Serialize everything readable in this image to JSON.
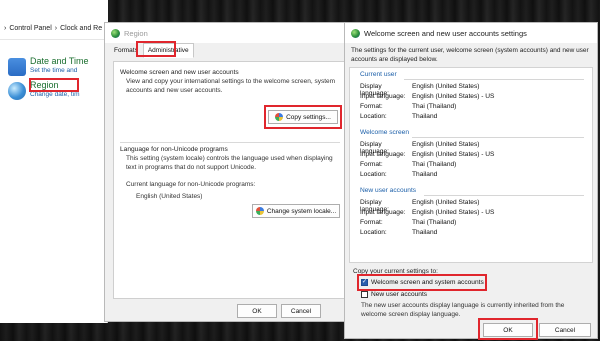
{
  "control_panel": {
    "breadcrumb": [
      "Control Panel",
      "Clock and Re"
    ],
    "items": [
      {
        "title": "Date and Time",
        "subtitle": "Set the time and"
      },
      {
        "title": "Region",
        "subtitle": "Change date, tim"
      }
    ]
  },
  "region_dialog": {
    "title": "Region",
    "tabs": [
      "Formats",
      "Administrative"
    ],
    "welcome_group": {
      "heading": "Welcome screen and new user accounts",
      "description": "View and copy your international settings to the welcome screen, system accounts and new user accounts.",
      "copy_button": "Copy settings..."
    },
    "unicode_group": {
      "heading": "Language for non-Unicode programs",
      "description": "This setting (system locale) controls the language used when displaying text in programs that do not support Unicode.",
      "current_label": "Current language for non-Unicode programs:",
      "current_value": "English (United States)",
      "change_button": "Change system locale..."
    },
    "ok": "OK",
    "cancel": "Cancel"
  },
  "welcome_dialog": {
    "title": "Welcome screen and new user accounts settings",
    "intro": "The settings for the current user, welcome screen (system accounts) and new user accounts are displayed below.",
    "sections": [
      {
        "name": "Current user",
        "rows": [
          [
            "Display language:",
            "English (United States)"
          ],
          [
            "Input language:",
            "English (United States) - US"
          ],
          [
            "Format:",
            "Thai (Thailand)"
          ],
          [
            "Location:",
            "Thailand"
          ]
        ]
      },
      {
        "name": "Welcome screen",
        "rows": [
          [
            "Display language:",
            "English (United States)"
          ],
          [
            "Input language:",
            "English (United States) - US"
          ],
          [
            "Format:",
            "Thai (Thailand)"
          ],
          [
            "Location:",
            "Thailand"
          ]
        ]
      },
      {
        "name": "New user accounts",
        "rows": [
          [
            "Display language:",
            "English (United States)"
          ],
          [
            "Input language:",
            "English (United States) - US"
          ],
          [
            "Format:",
            "Thai (Thailand)"
          ],
          [
            "Location:",
            "Thailand"
          ]
        ]
      }
    ],
    "copy_label": "Copy your current settings to:",
    "checkbox_welcome": "Welcome screen and system accounts",
    "checkbox_newuser": "New user accounts",
    "note": "The new user accounts display language is currently inherited from the welcome screen display language.",
    "ok": "OK",
    "cancel": "Cancel"
  },
  "colors": {
    "highlight": "#e0262d",
    "link": "#1a5ea8",
    "green": "#1a6e2e"
  }
}
